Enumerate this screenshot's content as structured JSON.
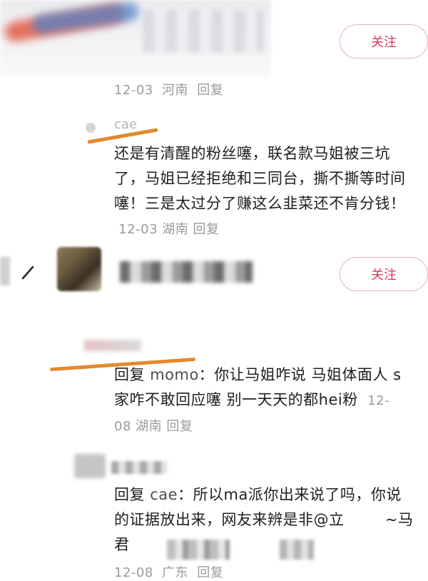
{
  "header": {
    "follow_label": "关注",
    "meta": {
      "date": "12-03",
      "location": "河南",
      "reply_label": "回复"
    }
  },
  "comment1": {
    "username": "cae",
    "text": "还是有清醒的粉丝噻，联名款马姐被三坑了，马姐已经拒绝和三同台，撕不撕等时间噻！三是太过分了赚这么韭菜还不肯分钱！",
    "date": "12-03",
    "location": "湖南",
    "reply_label": "回复"
  },
  "user_row": {
    "follow_label": "关注"
  },
  "comment2": {
    "reply_prefix": "回复",
    "reply_to": "momo",
    "text": "你让马姐咋说 马姐体面人 s家咋不敢回应噻 别一天天的都hei粉",
    "date": "12-08",
    "location": "湖南",
    "reply_label": "回复"
  },
  "comment3": {
    "reply_prefix": "回复",
    "reply_to": "cae",
    "text": "所以ma派你出来说了吗，你说的证据放出来，网友来辨是非@立",
    "tail": "~马君",
    "date": "12-08",
    "location": "广东",
    "reply_label": "回复"
  },
  "colors": {
    "accent_pink": "#d8395a",
    "orange_highlight": "#e3892d",
    "meta_gray": "#9a9a9a"
  }
}
